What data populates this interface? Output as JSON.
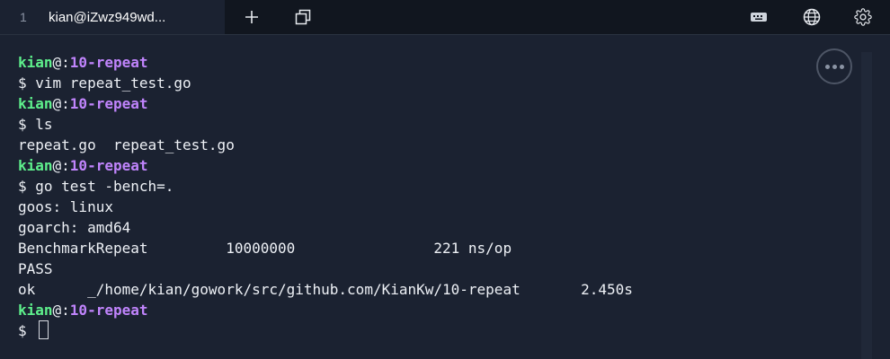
{
  "tabbar": {
    "tabs": [
      {
        "number": "1",
        "title": "kian@iZwz949wd..."
      }
    ]
  },
  "terminal": {
    "prompt_user": "kian",
    "prompt_sep": "@:",
    "prompt_path": "10-repeat",
    "lines": [
      {
        "kind": "prompt"
      },
      {
        "kind": "text",
        "text": "$ vim repeat_test.go"
      },
      {
        "kind": "prompt"
      },
      {
        "kind": "text",
        "text": "$ ls"
      },
      {
        "kind": "text",
        "text": "repeat.go  repeat_test.go"
      },
      {
        "kind": "prompt"
      },
      {
        "kind": "text",
        "text": "$ go test -bench=."
      },
      {
        "kind": "text",
        "text": "goos: linux"
      },
      {
        "kind": "text",
        "text": "goarch: amd64"
      },
      {
        "kind": "text",
        "text": "BenchmarkRepeat         10000000                221 ns/op"
      },
      {
        "kind": "text",
        "text": "PASS"
      },
      {
        "kind": "text",
        "text": "ok      _/home/kian/gowork/src/github.com/KianKw/10-repeat       2.450s"
      },
      {
        "kind": "prompt"
      },
      {
        "kind": "input",
        "text": "$ "
      }
    ]
  },
  "icons": {
    "new_tab": "plus-icon",
    "duplicate": "copy-icon",
    "keyboard": "keyboard-icon",
    "language": "globe-icon",
    "settings": "gear-icon",
    "more": "more-icon"
  },
  "colors": {
    "background": "#1b2231",
    "tabbar": "#11161f",
    "user": "#5ef08c",
    "path": "#c084fc",
    "text": "#eef1f6"
  }
}
